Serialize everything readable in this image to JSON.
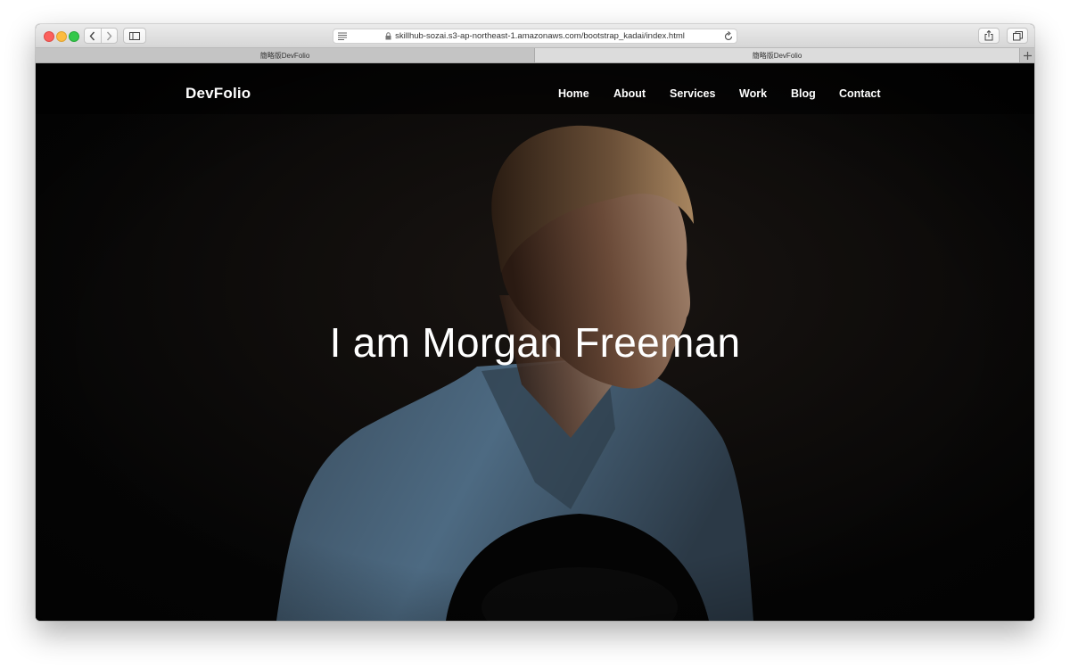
{
  "browser": {
    "url": "skillhub-sozai.s3-ap-northeast-1.amazonaws.com/bootstrap_kadai/index.html",
    "tabs": [
      {
        "title": "簡略版DevFolio",
        "active": false
      },
      {
        "title": "簡略版DevFolio",
        "active": true
      }
    ],
    "icons": {
      "back": "chevron-left-icon",
      "forward": "chevron-right-icon",
      "sidebar": "sidebar-icon",
      "reader": "reader-icon",
      "lock": "lock-icon",
      "reload": "reload-icon",
      "share": "share-icon",
      "tabs_overview": "tabs-overview-icon",
      "new_tab": "plus-icon"
    }
  },
  "site": {
    "brand": "DevFolio",
    "nav": [
      "Home",
      "About",
      "Services",
      "Work",
      "Blog",
      "Contact"
    ],
    "hero_title": "I am Morgan Freeman"
  },
  "colors": {
    "page_background": "#070707",
    "text": "#ffffff",
    "shirt": "#4d6a82"
  }
}
